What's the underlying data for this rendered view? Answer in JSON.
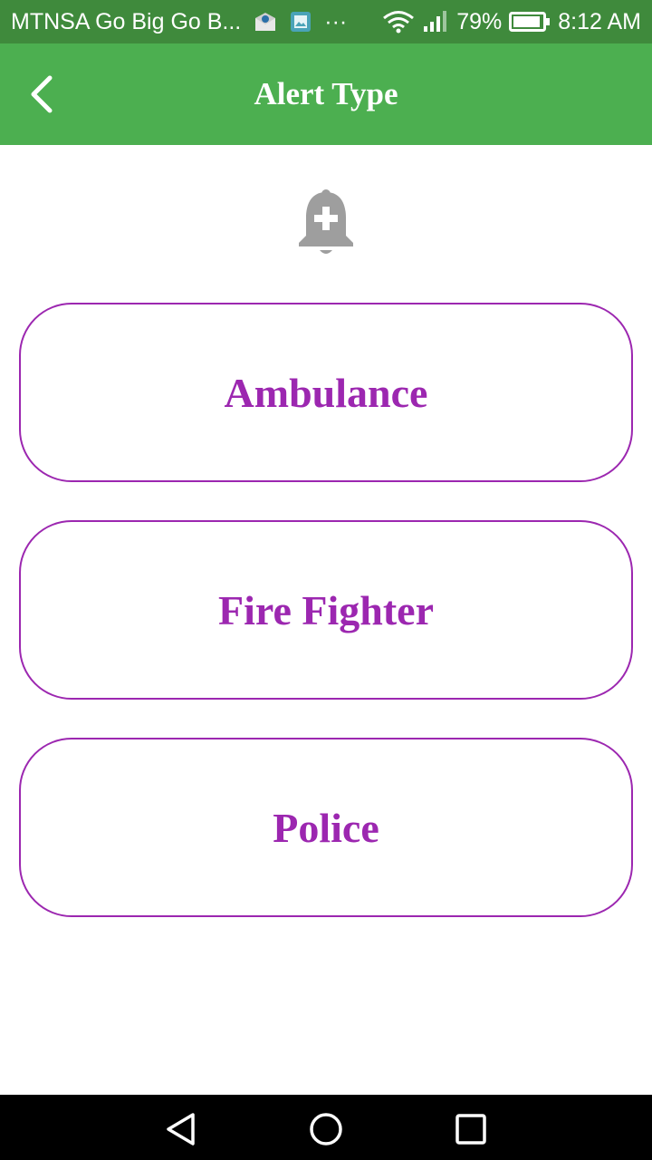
{
  "status_bar": {
    "carrier": "MTNSA Go Big Go B...",
    "more": "···",
    "battery_pct": "79%",
    "time": "8:12 AM",
    "icons": [
      "notification-mail-icon",
      "notification-image-icon",
      "wifi-icon",
      "cell-signal-icon",
      "battery-icon"
    ]
  },
  "app_bar": {
    "title": "Alert Type",
    "back_icon": "chevron-left-icon",
    "color": "#4caf50"
  },
  "hero": {
    "icon": "add-alert-bell-icon"
  },
  "options": [
    {
      "label": "Ambulance"
    },
    {
      "label": "Fire Fighter"
    },
    {
      "label": "Police"
    }
  ],
  "nav_bar": {
    "icons": [
      "nav-back-icon",
      "nav-home-icon",
      "nav-recents-icon"
    ]
  },
  "colors": {
    "status_bar": "#3f8a3c",
    "accent": "#9c27b0",
    "icon_gray": "#9e9e9e"
  }
}
